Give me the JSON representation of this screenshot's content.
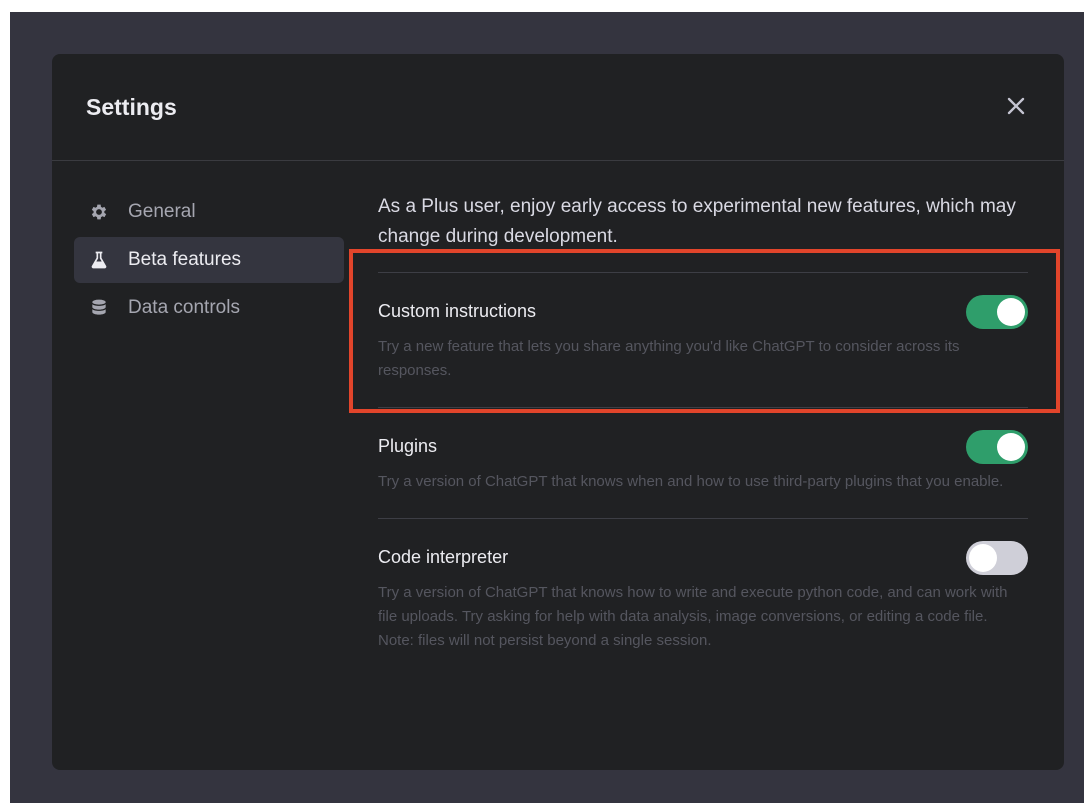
{
  "modal": {
    "title": "Settings",
    "close_label": "close"
  },
  "sidebar": {
    "items": [
      {
        "label": "General",
        "icon": "gear-icon",
        "active": false
      },
      {
        "label": "Beta features",
        "icon": "flask-icon",
        "active": true
      },
      {
        "label": "Data controls",
        "icon": "database-icon",
        "active": false
      }
    ]
  },
  "content": {
    "intro": "As a Plus user, enjoy early access to experimental new features, which may change during development.",
    "features": [
      {
        "title": "Custom instructions",
        "description": "Try a new feature that lets you share anything you'd like ChatGPT to consider across its responses.",
        "enabled": true
      },
      {
        "title": "Plugins",
        "description": "Try a version of ChatGPT that knows when and how to use third-party plugins that you enable.",
        "enabled": true
      },
      {
        "title": "Code interpreter",
        "description": "Try a version of ChatGPT that knows how to write and execute python code, and can work with file uploads. Try asking for help with data analysis, image conversions, or editing a code file. Note: files will not persist beyond a single session.",
        "enabled": false
      }
    ]
  },
  "colors": {
    "highlight": "#e2452b",
    "toggle_on": "#2f9e6b",
    "toggle_off": "#cfcfd8",
    "modal_bg": "#202123"
  }
}
